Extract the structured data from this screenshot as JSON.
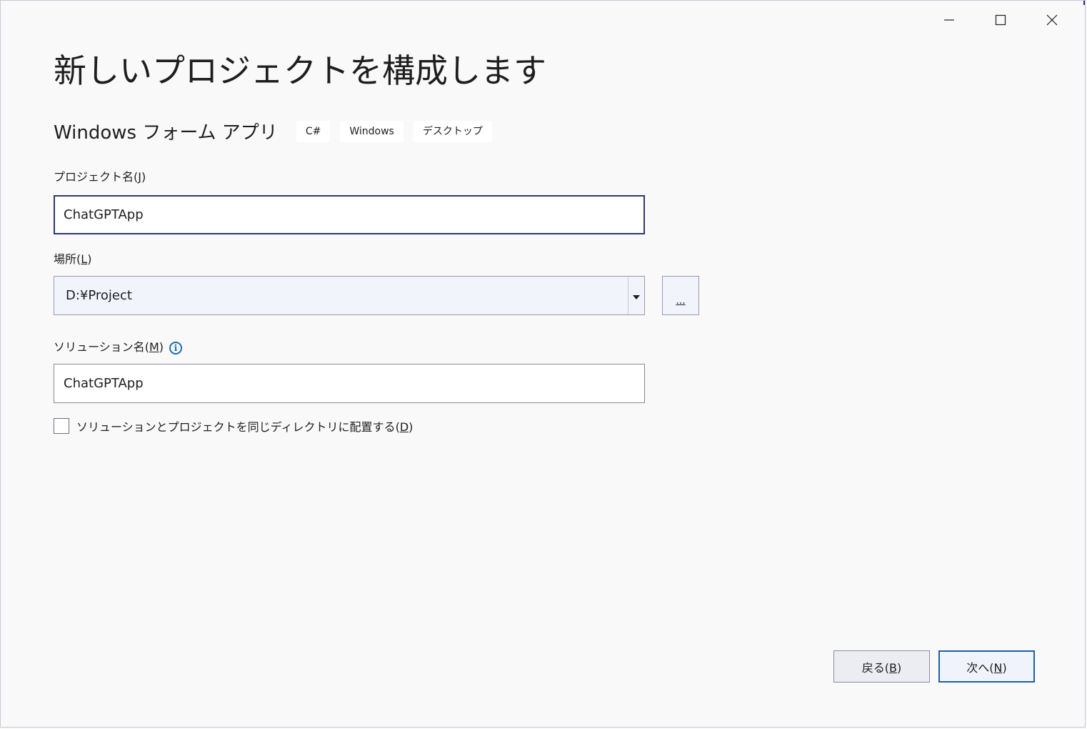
{
  "window": {
    "controls": {
      "minimize_icon": "minimize-icon",
      "maximize_icon": "maximize-icon",
      "close_icon": "close-icon"
    }
  },
  "page": {
    "title": "新しいプロジェクトを構成します"
  },
  "template": {
    "name": "Windows フォーム アプリ",
    "tags": [
      "C#",
      "Windows",
      "デスクトップ"
    ]
  },
  "project_name": {
    "label": "プロジェクト名",
    "accel": "J",
    "value": "ChatGPTApp"
  },
  "location": {
    "label": "場所",
    "accel": "L",
    "value": "D:¥Project",
    "browse_label": "..."
  },
  "solution_name": {
    "label": "ソリューション名",
    "accel": "M",
    "value": "ChatGPTApp",
    "info_icon": "info-icon"
  },
  "same_dir": {
    "label": "ソリューションとプロジェクトを同じディレクトリに配置する",
    "accel": "D",
    "checked": false
  },
  "buttons": {
    "back": {
      "label": "戻る",
      "accel": "B"
    },
    "next": {
      "label": "次へ",
      "accel": "N"
    }
  },
  "colors": {
    "background": "#f9f9fa",
    "focus_border": "#2a3a6e",
    "primary_border": "#1f5fa8",
    "info_blue": "#1a6fb0"
  }
}
